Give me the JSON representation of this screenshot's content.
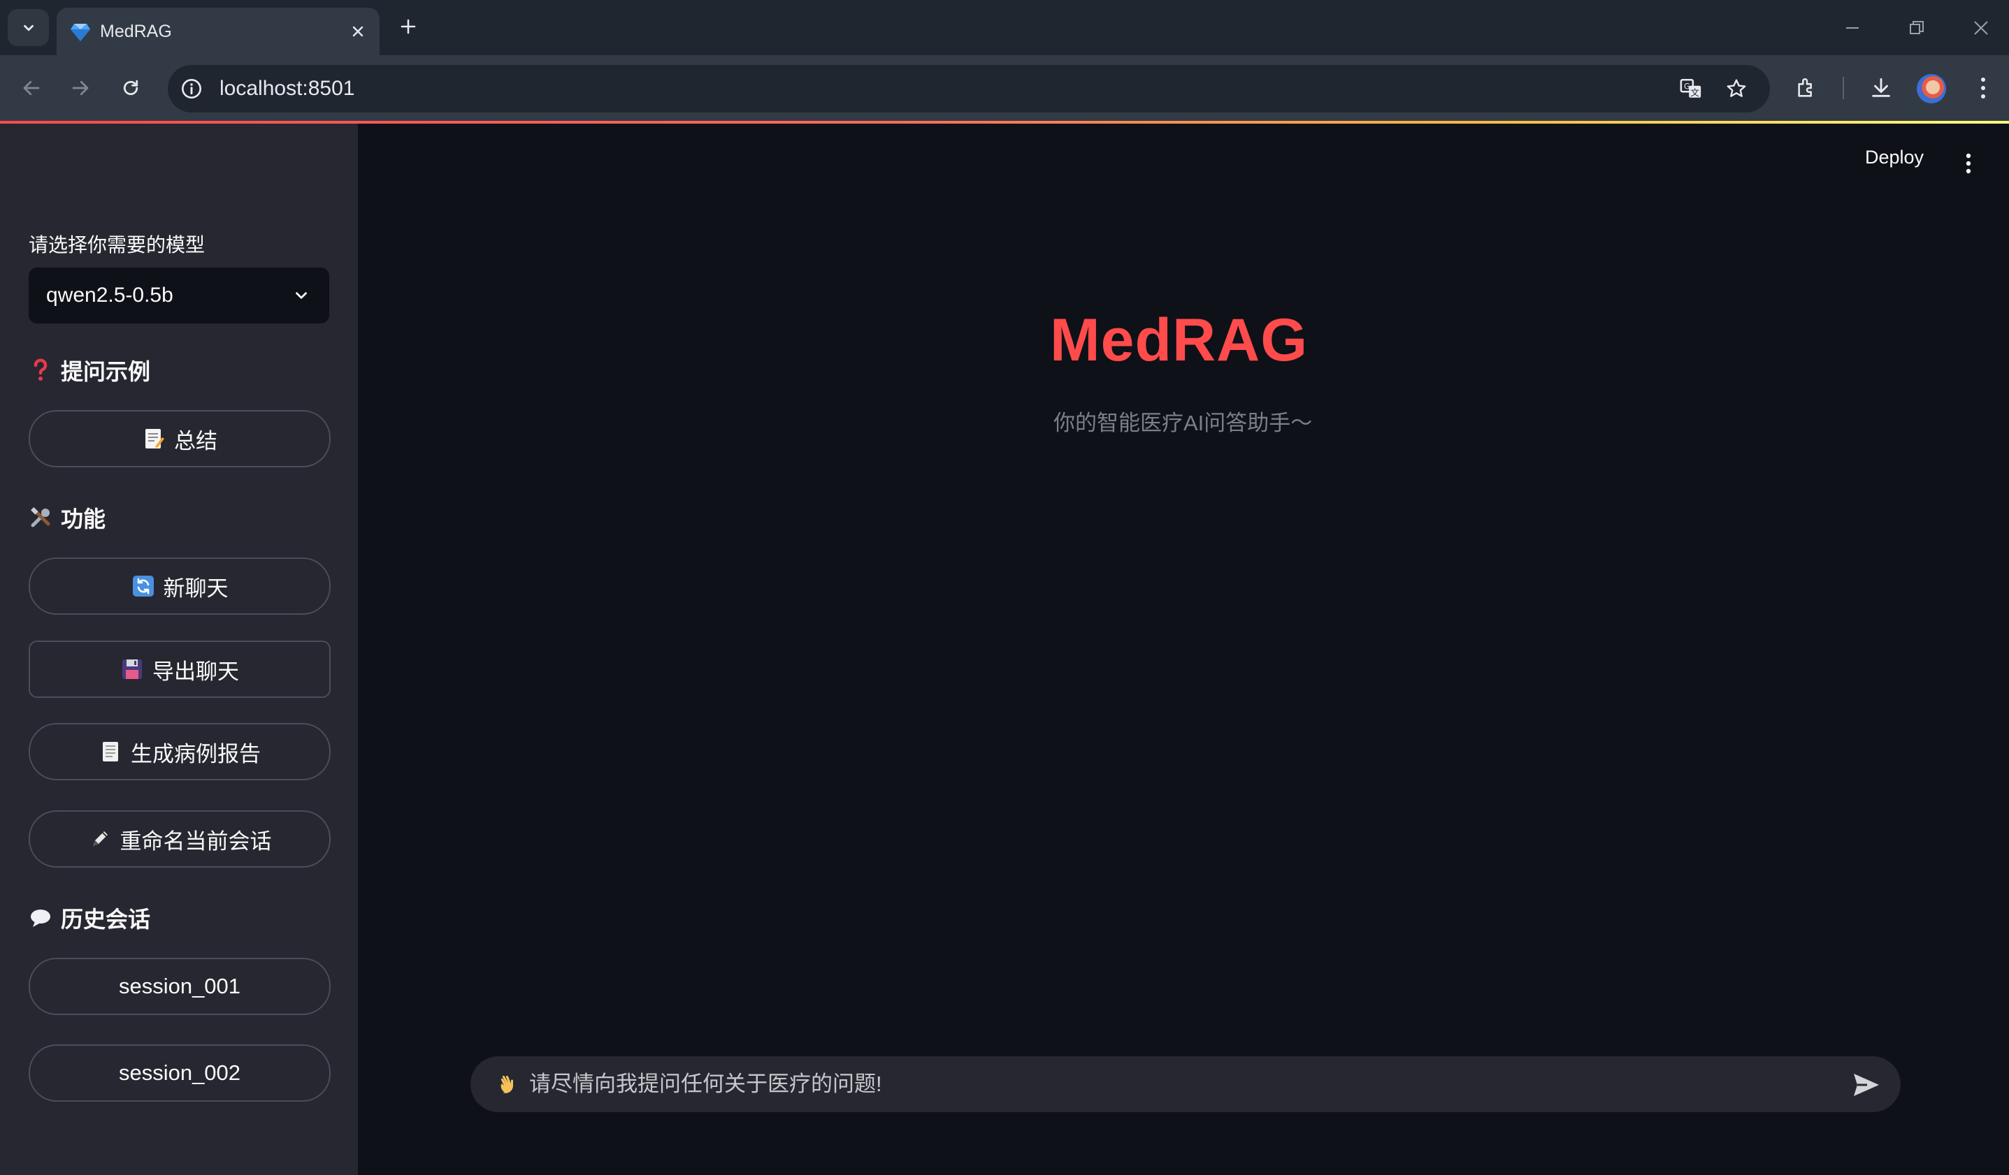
{
  "browser": {
    "tab_title": "MedRAG",
    "url": "localhost:8501",
    "icons": [
      "tab-search-icon",
      "diamond-favicon-icon",
      "close-icon",
      "plus-icon",
      "back-icon",
      "forward-icon",
      "reload-icon",
      "info-icon",
      "translate-icon",
      "star-icon",
      "extensions-icon",
      "download-icon",
      "profile-avatar",
      "menu-icon"
    ]
  },
  "sidebar": {
    "model_label": "请选择你需要的模型",
    "model_selected": "qwen2.5-0.5b",
    "examples_heading": "提问示例",
    "examples": [
      {
        "label": "总结",
        "icon": "memo-icon"
      }
    ],
    "functions_heading": "功能",
    "functions": [
      {
        "label": "新聊天",
        "icon": "refresh-icon"
      },
      {
        "label": "导出聊天",
        "icon": "floppy-disk-icon"
      },
      {
        "label": "生成病例报告",
        "icon": "page-icon"
      },
      {
        "label": "重命名当前会话",
        "icon": "pencil-icon"
      }
    ],
    "history_heading": "历史会话",
    "history": [
      {
        "label": "session_001"
      },
      {
        "label": "session_002"
      }
    ]
  },
  "main": {
    "deploy_label": "Deploy",
    "title": "MedRAG",
    "subtitle": "你的智能医疗AI问答助手～",
    "chat_placeholder": "请尽情向我提问任何关于医疗的问题!"
  },
  "colors": {
    "accent": "#ff4b4b",
    "background": "#0e1117",
    "sidebar": "#262730"
  }
}
